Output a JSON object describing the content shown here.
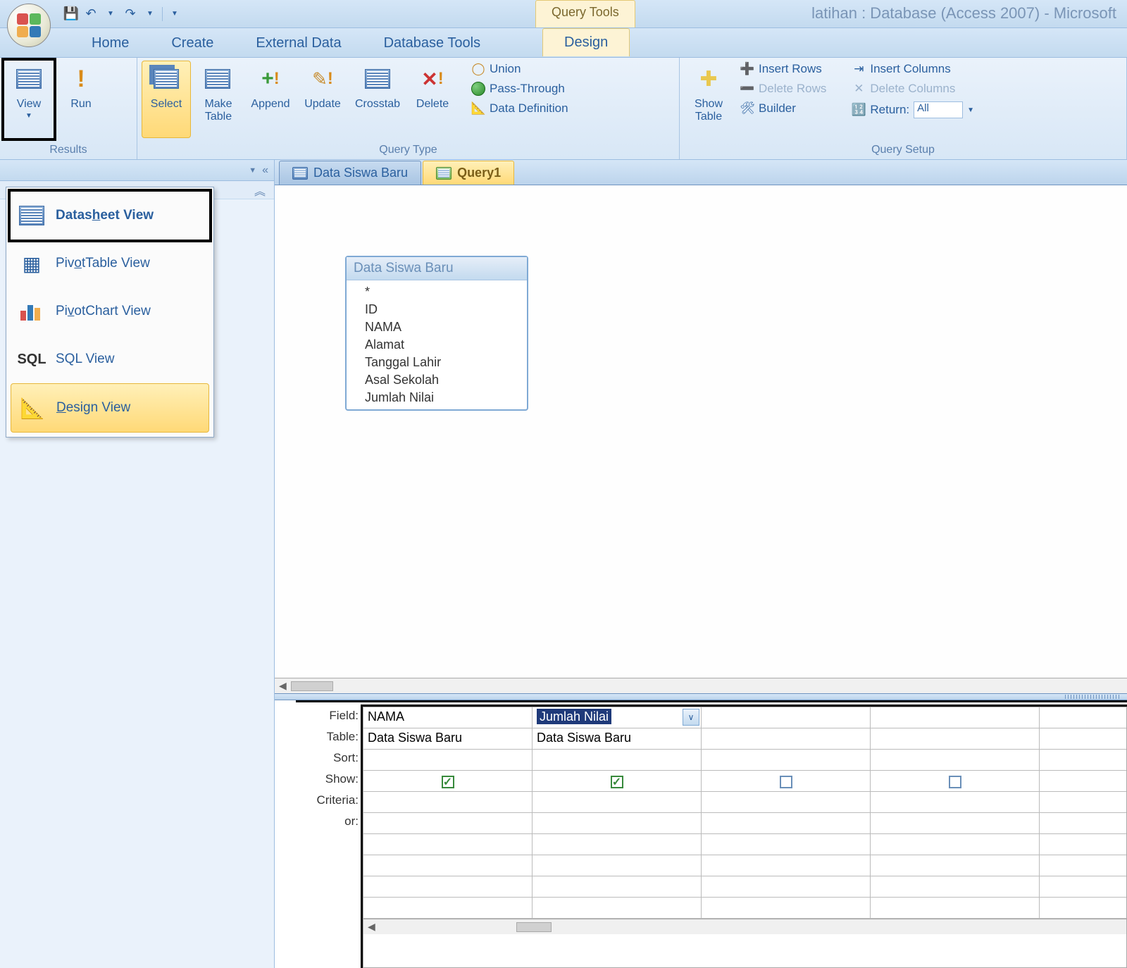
{
  "app": {
    "title": "latihan : Database (Access 2007) - Microsoft",
    "context_tool": "Query Tools"
  },
  "qat": {
    "save": "💾",
    "undo": "↶",
    "redo": "↷"
  },
  "tabs": {
    "home": "Home",
    "create": "Create",
    "external": "External Data",
    "dbtools": "Database Tools",
    "design": "Design"
  },
  "ribbon": {
    "results": {
      "view": "View",
      "run": "Run",
      "group": "Results"
    },
    "qtype": {
      "select": "Select",
      "make_table": "Make\nTable",
      "append": "Append",
      "update": "Update",
      "crosstab": "Crosstab",
      "delete": "Delete",
      "union": "Union",
      "passthrough": "Pass-Through",
      "datadef": "Data Definition",
      "group": "Query Type"
    },
    "setup": {
      "show_table": "Show\nTable",
      "insert_rows": "Insert Rows",
      "delete_rows": "Delete Rows",
      "builder": "Builder",
      "insert_cols": "Insert Columns",
      "delete_cols": "Delete Columns",
      "return": "Return:",
      "return_val": "All",
      "group": "Query Setup"
    }
  },
  "view_menu": {
    "datasheet": "Datasheet View",
    "pivottable": "PivotTable View",
    "pivotchart": "PivotChart View",
    "sql": "SQL View",
    "design": "Design View"
  },
  "doc_tabs": {
    "t1": "Data Siswa Baru",
    "t2": "Query1"
  },
  "table_box": {
    "title": "Data Siswa Baru",
    "fields": [
      "*",
      "ID",
      "NAMA",
      "Alamat",
      "Tanggal Lahir",
      "Asal Sekolah",
      "Jumlah Nilai"
    ]
  },
  "qbe": {
    "labels": {
      "field": "Field:",
      "table": "Table:",
      "sort": "Sort:",
      "show": "Show:",
      "criteria": "Criteria:",
      "or": "or:"
    },
    "cols": [
      {
        "field": "NAMA",
        "table": "Data Siswa Baru",
        "show": true
      },
      {
        "field": "Jumlah Nilai",
        "table": "Data Siswa Baru",
        "show": true,
        "selected": true
      },
      {
        "field": "",
        "table": "",
        "show": false
      },
      {
        "field": "",
        "table": "",
        "show": false
      }
    ]
  }
}
